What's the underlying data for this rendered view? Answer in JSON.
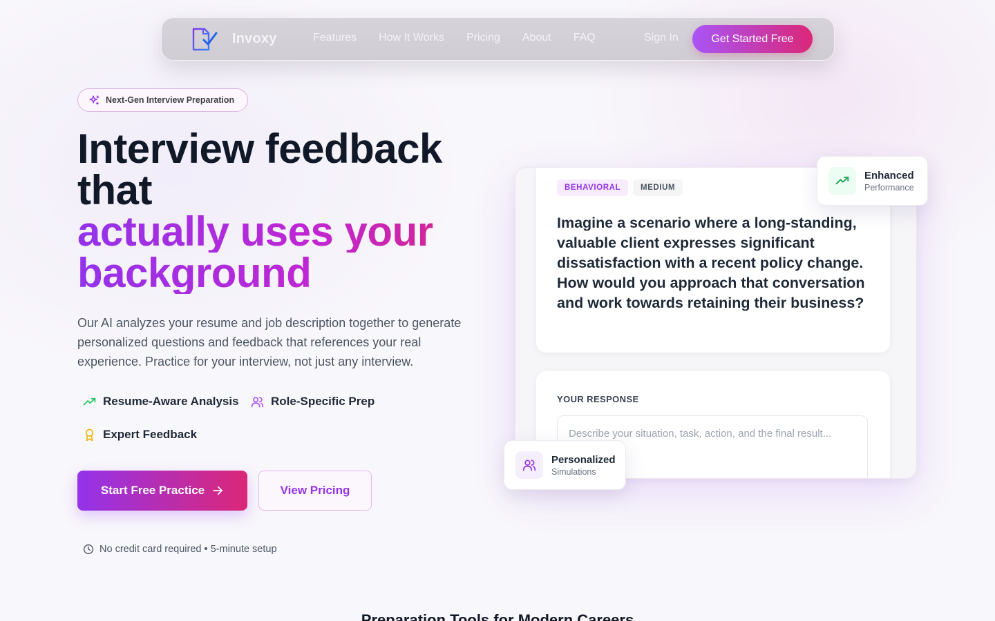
{
  "nav": {
    "brand": "Invoxy",
    "links": [
      "Features",
      "How It Works",
      "Pricing",
      "About",
      "FAQ"
    ],
    "sign_in": "Sign In",
    "cta": "Get Started Free"
  },
  "hero": {
    "badge": "Next-Gen Interview Preparation",
    "title_line1": "Interview feedback",
    "title_line2": "that",
    "title_highlight_line1": "actually uses your",
    "title_highlight_line2": "background",
    "description": "Our AI analyzes your resume and job description together to generate personalized questions and feedback that references your real experience. Practice for your interview, not just any interview.",
    "features": [
      {
        "label": "Resume-Aware Analysis",
        "icon": "trending-up-icon"
      },
      {
        "label": "Role-Specific Prep",
        "icon": "users-icon"
      },
      {
        "label": "Expert Feedback",
        "icon": "award-icon"
      }
    ],
    "primary_button": "Start Free Practice",
    "secondary_button": "View Pricing",
    "note": "No credit card required • 5-minute setup"
  },
  "mock": {
    "tags": [
      "BEHAVIORAL",
      "MEDIUM"
    ],
    "question": "Imagine a scenario where a long-standing, valuable client expresses significant dissatisfaction with a recent policy change. How would you approach that conversation and work towards retaining their business?",
    "response_label": "YOUR RESPONSE",
    "response_placeholder": "Describe your situation, task, action, and the final result..."
  },
  "floats": {
    "enhanced": {
      "title": "Enhanced",
      "subtitle": "Performance"
    },
    "personalized": {
      "title": "Personalized",
      "subtitle": "Simulations"
    }
  },
  "next_section": {
    "title": "Preparation Tools for Modern Careers"
  },
  "colors": {
    "brand_purple": "#9333ea",
    "brand_pink": "#db2777",
    "success_green": "#22c55e",
    "award_amber": "#eab308"
  }
}
